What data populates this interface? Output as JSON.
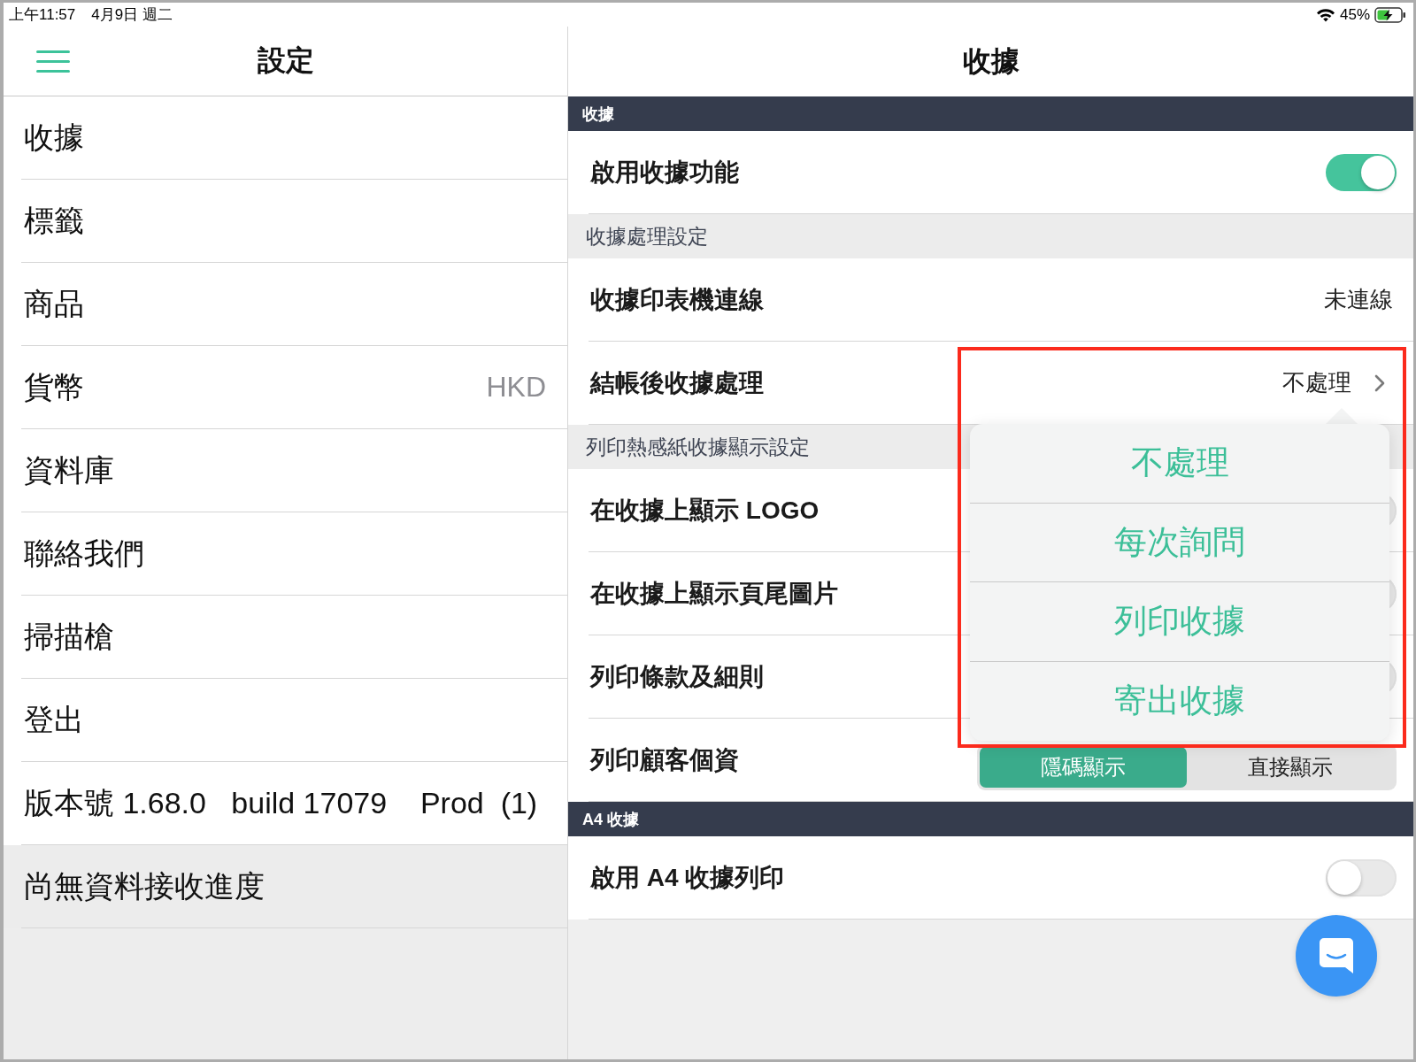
{
  "status_bar": {
    "time": "上午11:57",
    "date": "4月9日 週二",
    "battery": "45%"
  },
  "sidebar": {
    "title": "設定",
    "items": [
      {
        "label": "收據"
      },
      {
        "label": "標籤"
      },
      {
        "label": "商品"
      },
      {
        "label": "貨幣",
        "value": "HKD"
      },
      {
        "label": "資料庫"
      },
      {
        "label": "聯絡我們"
      },
      {
        "label": "掃描槍"
      },
      {
        "label": "登出"
      },
      {
        "label": "版本號 1.68.0   build 17079    Prod  (1)"
      }
    ],
    "footer": "尚無資料接收進度"
  },
  "detail": {
    "title": "收據",
    "sections": [
      {
        "kind": "dark",
        "title": "收據",
        "rows": [
          {
            "kind": "toggle",
            "label": "啟用收據功能",
            "on": true
          }
        ]
      },
      {
        "kind": "light",
        "title": "收據處理設定",
        "rows": [
          {
            "kind": "value",
            "label": "收據印表機連線",
            "value": "未連線"
          },
          {
            "kind": "disclosure",
            "label": "結帳後收據處理",
            "value": "不處理"
          }
        ]
      },
      {
        "kind": "light",
        "title": "列印熱感紙收據顯示設定",
        "rows": [
          {
            "kind": "toggle",
            "label": "在收據上顯示 LOGO",
            "on": false
          },
          {
            "kind": "toggle",
            "label": "在收據上顯示頁尾圖片",
            "on": false
          },
          {
            "kind": "toggle",
            "label": "列印條款及細則",
            "on": false
          },
          {
            "kind": "segmented",
            "label": "列印顧客個資",
            "options": [
              {
                "label": "隱碼顯示",
                "selected": true
              },
              {
                "label": "直接顯示",
                "selected": false
              }
            ]
          }
        ]
      },
      {
        "kind": "dark",
        "title": "A4 收據",
        "rows": [
          {
            "kind": "toggle",
            "label": "啟用 A4 收據列印",
            "on": false
          }
        ]
      }
    ]
  },
  "popover": {
    "highlighted": true,
    "options": [
      "不處理",
      "每次詢問",
      "列印收據",
      "寄出收據"
    ]
  }
}
